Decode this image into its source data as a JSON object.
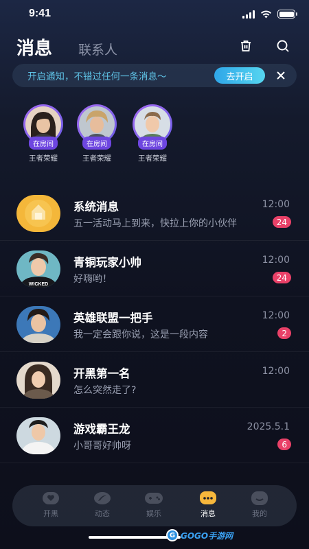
{
  "status_bar": {
    "time": "9:41"
  },
  "header": {
    "active_tab": "消息",
    "inactive_tab": "联系人",
    "trash_icon": "trash-icon",
    "search_icon": "search-icon"
  },
  "notice": {
    "text": "开启通知，不错过任何一条消息～",
    "button": "去开启",
    "close_icon": "close-icon"
  },
  "room_users": [
    {
      "badge": "在房间",
      "name": "王者荣耀"
    },
    {
      "badge": "在房间",
      "name": "王者荣耀"
    },
    {
      "badge": "在房间",
      "name": "王者荣耀"
    }
  ],
  "messages": [
    {
      "name": "系统消息",
      "time": "12:00",
      "preview": "五一活动马上到来，快拉上你的小伙伴",
      "badge": "24"
    },
    {
      "name": "青铜玩家小帅",
      "time": "12:00",
      "preview": "好嗨哟！",
      "badge": "24"
    },
    {
      "name": "英雄联盟一把手",
      "time": "12:00",
      "preview": "我一定会跟你说，这是一段内容",
      "badge": "2"
    },
    {
      "name": "开黑第一名",
      "time": "12:00",
      "preview": "怎么突然走了?",
      "badge": ""
    },
    {
      "name": "游戏霸王龙",
      "time": "2025.5.1",
      "preview": "小哥哥好帅呀",
      "badge": "6"
    }
  ],
  "bottom_nav": [
    {
      "label": "开黑",
      "icon": "heart-chat-icon"
    },
    {
      "label": "动态",
      "icon": "leaf-icon"
    },
    {
      "label": "娱乐",
      "icon": "gamepad-icon"
    },
    {
      "label": "消息",
      "icon": "message-icon",
      "active": true
    },
    {
      "label": "我的",
      "icon": "profile-icon"
    }
  ],
  "watermark": {
    "logo": "G",
    "text": "GOGO手游网"
  },
  "colors": {
    "accent": "#2fa6e8",
    "badge": "#e94168",
    "room_ring": "#8f63ec",
    "active_nav": "#f6b73c"
  }
}
